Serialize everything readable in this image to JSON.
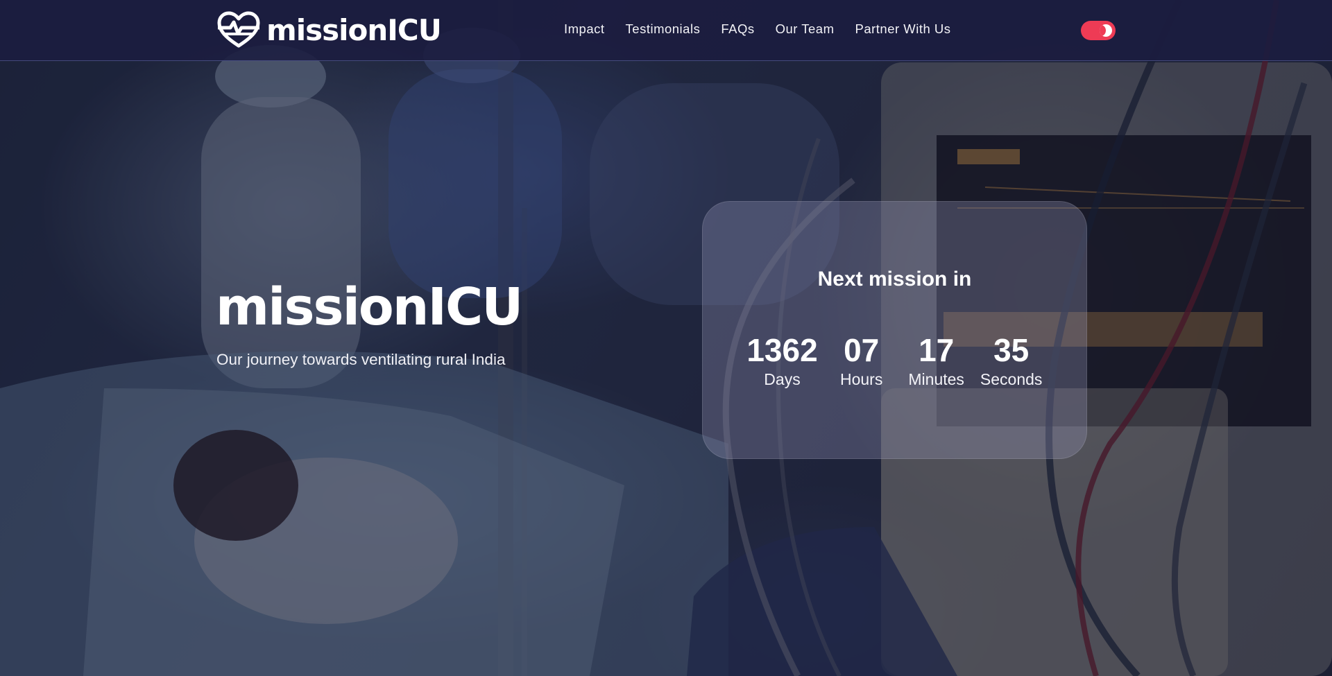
{
  "brand": {
    "name": "missionICU",
    "logo_icon": "heart-pulse-icon"
  },
  "nav": {
    "links": [
      {
        "label": "Impact"
      },
      {
        "label": "Testimonials"
      },
      {
        "label": "FAQs"
      },
      {
        "label": "Our Team"
      },
      {
        "label": "Partner With Us"
      }
    ],
    "theme_toggle": {
      "icon": "moon-icon",
      "state": "on"
    }
  },
  "hero": {
    "title": "missionICU",
    "subtitle": "Our journey towards ventilating rural India"
  },
  "countdown": {
    "heading": "Next mission in",
    "units": [
      {
        "value": "1362",
        "label": "Days"
      },
      {
        "value": "07",
        "label": "Hours"
      },
      {
        "value": "17",
        "label": "Minutes"
      },
      {
        "value": "35",
        "label": "Seconds"
      }
    ]
  },
  "colors": {
    "navbar": "#1b1c40",
    "toggle_accent": "#ee3b55",
    "text": "#ffffff"
  }
}
